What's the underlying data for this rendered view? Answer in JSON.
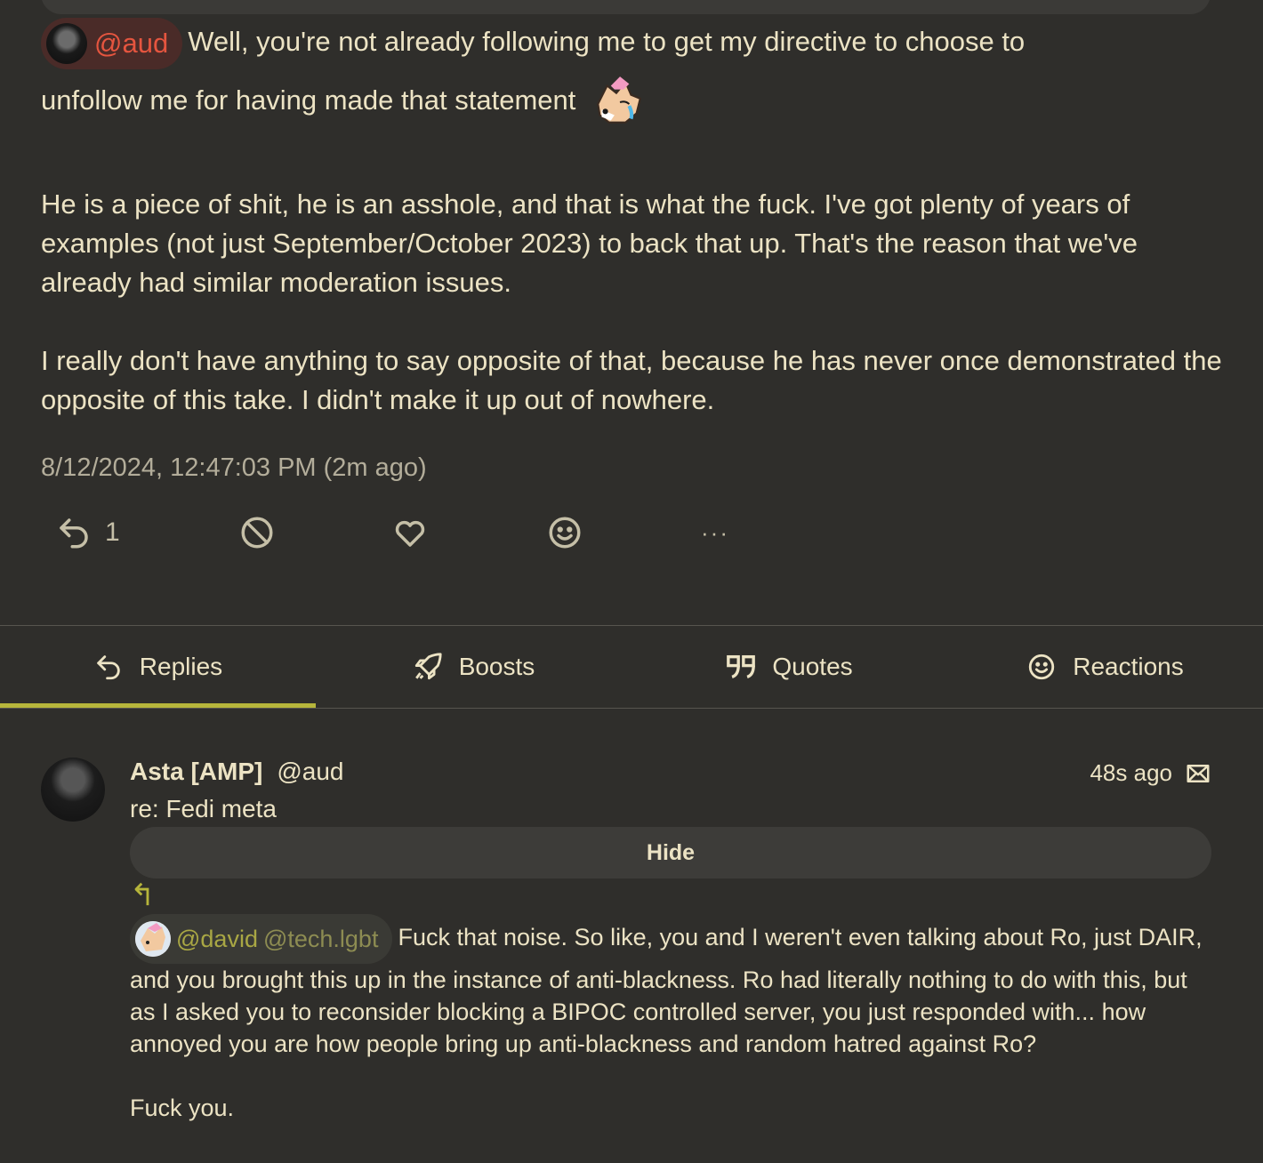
{
  "main_post": {
    "mention": "@aud",
    "line1_rest": "Well, you're not already following me to get my directive to choose to",
    "line2": "unfollow me for having made that statement",
    "paragraph2": "He is a piece of shit, he is an asshole, and that is what the fuck. I've got plenty of years of examples (not just September/October 2023) to back that up. That's the reason that we've already had similar moderation issues.",
    "paragraph3": "I really don't have anything to say opposite of that, because he has never once demonstrated the opposite of this take. I didn't make it up out of nowhere.",
    "timestamp": "8/12/2024, 12:47:03 PM (2m ago)",
    "reply_count": "1"
  },
  "actions": {
    "icons": [
      "reply-icon",
      "blocked-icon",
      "heart-icon",
      "smiley-icon",
      "more-icon"
    ],
    "more_label": "···"
  },
  "tabs": [
    {
      "label": "Replies",
      "icon": "reply-icon",
      "active": true
    },
    {
      "label": "Boosts",
      "icon": "rocket-icon",
      "active": false
    },
    {
      "label": "Quotes",
      "icon": "quote-icon",
      "active": false
    },
    {
      "label": "Reactions",
      "icon": "smiley-icon",
      "active": false
    }
  ],
  "reply": {
    "display_name": "Asta [AMP]",
    "handle": "@aud",
    "time": "48s ago",
    "subject": "re: Fedi meta",
    "hide_label": "Hide",
    "arrow": "↰",
    "mention_user": "@david",
    "mention_host": "@tech.lgbt",
    "text_rest": "Fuck that noise.  So like, you and I weren't even talking about Ro, just DAIR, and you brought this up in the instance of anti-blackness.  Ro had literally nothing to do with this, but as I asked you to reconsider blocking a BIPOC controlled server, you just responded with... how annoyed you are how people bring up anti-blackness and random hatred against Ro?",
    "text_last": "Fuck you."
  },
  "colors": {
    "background": "#2f2e2b",
    "text": "#ece3c4",
    "accent": "#b6b53b",
    "mention_red": "#e5553f"
  }
}
